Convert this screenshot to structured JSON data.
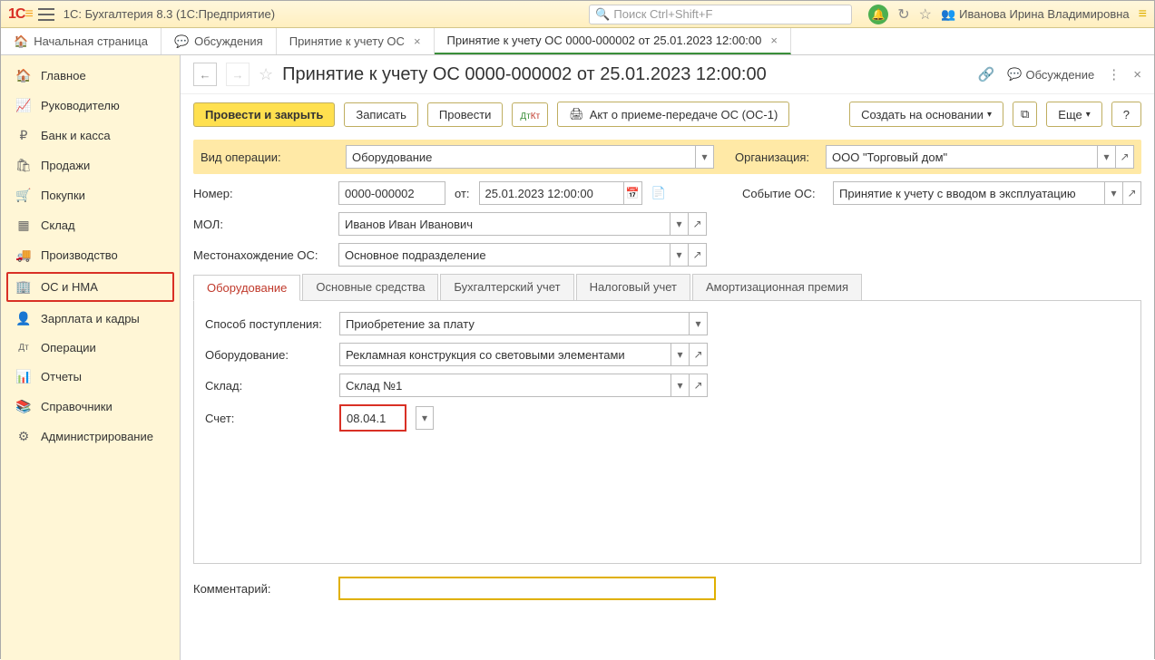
{
  "app": {
    "title": "1С: Бухгалтерия 8.3  (1С:Предприятие)",
    "search_placeholder": "Поиск Ctrl+Shift+F",
    "user": "Иванова Ирина Владимировна"
  },
  "tabs": [
    {
      "label": "Начальная страница"
    },
    {
      "label": "Обсуждения"
    },
    {
      "label": "Принятие к учету ОС"
    },
    {
      "label": "Принятие к учету ОС 0000-000002 от 25.01.2023 12:00:00"
    }
  ],
  "sidebar": [
    {
      "label": "Главное",
      "icon": "🏠"
    },
    {
      "label": "Руководителю",
      "icon": "📈"
    },
    {
      "label": "Банк и касса",
      "icon": "₽"
    },
    {
      "label": "Продажи",
      "icon": "🛍"
    },
    {
      "label": "Покупки",
      "icon": "🛒"
    },
    {
      "label": "Склад",
      "icon": "▦"
    },
    {
      "label": "Производство",
      "icon": "🚚"
    },
    {
      "label": "ОС и НМА",
      "icon": "🏢"
    },
    {
      "label": "Зарплата и кадры",
      "icon": "👤"
    },
    {
      "label": "Операции",
      "icon": "Дт"
    },
    {
      "label": "Отчеты",
      "icon": "📊"
    },
    {
      "label": "Справочники",
      "icon": "📚"
    },
    {
      "label": "Администрирование",
      "icon": "⚙"
    }
  ],
  "doc": {
    "title": "Принятие к учету ОС 0000-000002 от 25.01.2023 12:00:00",
    "discuss": "Обсуждение",
    "toolbar": {
      "primary": "Провести и закрыть",
      "save": "Записать",
      "post": "Провести",
      "print": "Акт о приеме-передаче ОС (ОС-1)",
      "create_based": "Создать на основании",
      "more": "Еще",
      "help": "?"
    },
    "labels": {
      "op_type": "Вид операции:",
      "number": "Номер:",
      "from": "от:",
      "org": "Организация:",
      "event": "Событие ОС:",
      "mol": "МОЛ:",
      "location": "Местонахождение ОС:",
      "method": "Способ поступления:",
      "equipment": "Оборудование:",
      "warehouse": "Склад:",
      "account": "Счет:",
      "comment": "Комментарий:"
    },
    "values": {
      "op_type": "Оборудование",
      "number": "0000-000002",
      "date": "25.01.2023 12:00:00",
      "org": "ООО \"Торговый дом\"",
      "event": "Принятие к учету с вводом в эксплуатацию",
      "mol": "Иванов Иван Иванович",
      "location": "Основное подразделение",
      "method": "Приобретение за плату",
      "equipment": "Рекламная конструкция со световыми элементами",
      "warehouse": "Склад №1",
      "account": "08.04.1"
    },
    "tabs2": [
      "Оборудование",
      "Основные средства",
      "Бухгалтерский учет",
      "Налоговый учет",
      "Амортизационная премия"
    ]
  }
}
